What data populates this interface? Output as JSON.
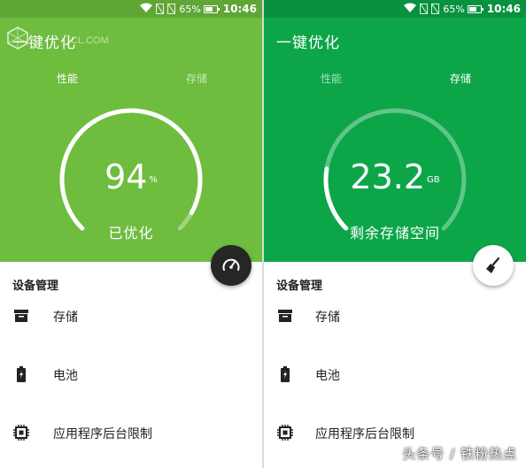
{
  "colors": {
    "left_header": "#6ebd3f",
    "right_header": "#0ca649",
    "fab_dark": "#262626"
  },
  "status_bar": {
    "battery": "65%",
    "time": "10:46"
  },
  "watermark": {
    "text": "CL.COM"
  },
  "left": {
    "title": "一键优化",
    "tabs": [
      {
        "label": "性能",
        "active": true
      },
      {
        "label": "存储",
        "active": false
      }
    ],
    "gauge": {
      "value": "94",
      "unit": "%",
      "label": "已优化",
      "fraction": 0.94
    },
    "fab_icon": "speedometer-icon"
  },
  "right": {
    "title": "一键优化",
    "tabs": [
      {
        "label": "性能",
        "active": false
      },
      {
        "label": "存储",
        "active": true
      }
    ],
    "gauge": {
      "value": "23.2",
      "unit": "GB",
      "label": "剩余存储空间",
      "fraction": 0.2
    },
    "fab_icon": "broom-icon"
  },
  "device": {
    "section_title": "设备管理",
    "items": [
      {
        "label": "存储",
        "icon": "storage-box-icon"
      },
      {
        "label": "电池",
        "icon": "battery-icon"
      },
      {
        "label": "应用程序后台限制",
        "icon": "chip-icon"
      }
    ]
  },
  "credit": "头条号 / 铁粉热点"
}
